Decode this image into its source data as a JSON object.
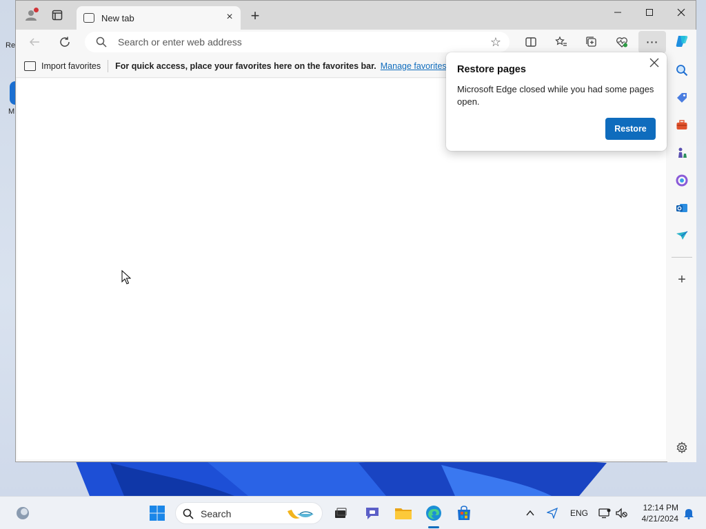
{
  "desktop": {
    "icon_labels": [
      "Re",
      "M"
    ]
  },
  "browser": {
    "tab": {
      "title": "New tab"
    },
    "toolbar": {
      "address_placeholder": "Search or enter web address"
    },
    "favorites_bar": {
      "import_label": "Import favorites",
      "message": "For quick access, place your favorites here on the favorites bar.",
      "manage_link": "Manage favorites now"
    },
    "sidebar": {
      "icons": [
        "copilot-icon",
        "search-icon",
        "shopping-tag-icon",
        "tools-briefcase-icon",
        "games-chess-icon",
        "office-icon",
        "outlook-icon",
        "drop-send-icon",
        "add-icon",
        "settings-gear-icon"
      ]
    },
    "restore_popup": {
      "title": "Restore pages",
      "message": "Microsoft Edge closed while you had some pages open.",
      "button_label": "Restore"
    }
  },
  "taskbar": {
    "search_label": "Search",
    "language": "ENG",
    "time": "12:14 PM",
    "date": "4/21/2024"
  },
  "colors": {
    "accent": "#0f6cbd",
    "titlebar": "#d9d9d9",
    "wallpaper_blue": "#1d4fd6"
  }
}
